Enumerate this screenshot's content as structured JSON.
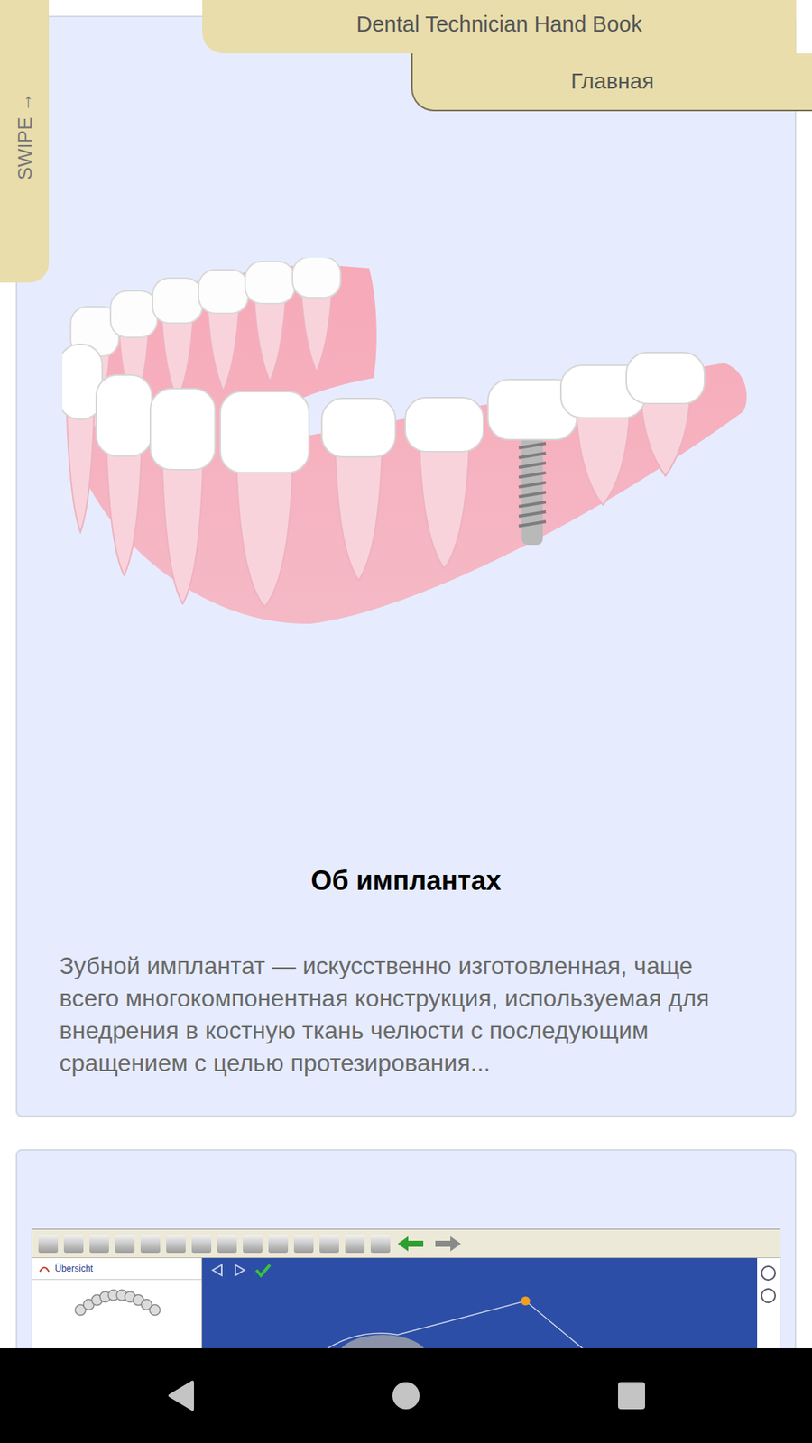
{
  "header": {
    "title": "Dental Technician Hand Book",
    "breadcrumb": "Главная"
  },
  "swipe": {
    "label": "SWIPE →"
  },
  "article": {
    "title": "Об имплантах",
    "text": "Зубной имплантат — искусственно изготовленная, чаще всего многокомпонентная конструкция, используемая для внедрения в костную ткань челюсти с последующим сращением с целью протезирования..."
  },
  "next_card": {
    "screenshot": {
      "tab_label": "Übersicht"
    }
  }
}
